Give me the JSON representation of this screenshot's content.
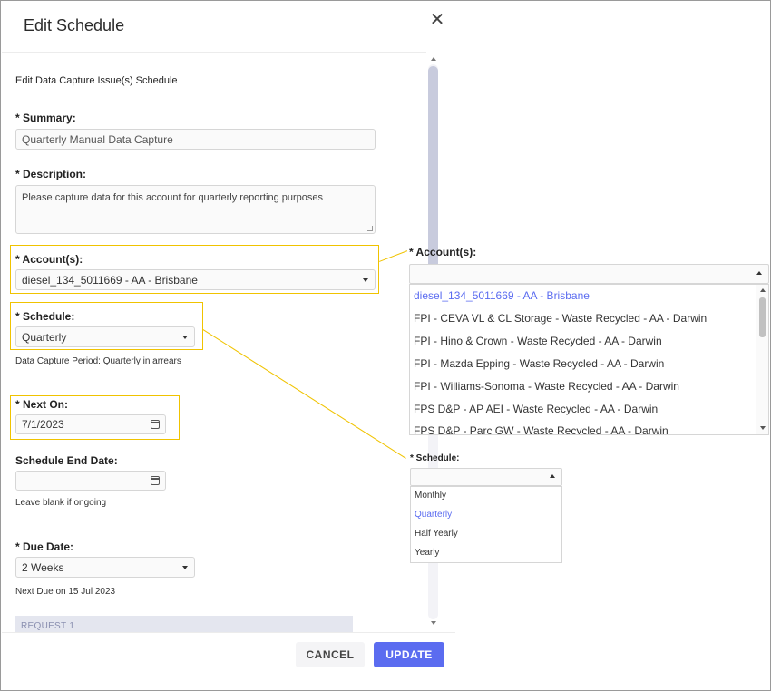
{
  "dialog": {
    "title": "Edit Schedule",
    "close_glyph": "✕"
  },
  "form": {
    "section_title": "Edit Data Capture Issue(s) Schedule",
    "summary": {
      "label": "* Summary:",
      "value": "Quarterly Manual Data Capture"
    },
    "description": {
      "label": "* Description:",
      "value": "Please capture data for this account for quarterly reporting purposes"
    },
    "accounts": {
      "label": "* Account(s):",
      "value": "diesel_134_5011669 - AA - Brisbane"
    },
    "schedule": {
      "label": "* Schedule:",
      "value": "Quarterly",
      "helper": "Data Capture Period: Quarterly in arrears"
    },
    "next_on": {
      "label": "* Next On:",
      "value": "7/1/2023"
    },
    "schedule_end": {
      "label": "Schedule End Date:",
      "value": "",
      "helper": "Leave blank if ongoing"
    },
    "due_date": {
      "label": "* Due Date:",
      "value": "2 Weeks",
      "helper": "Next Due on 15 Jul 2023"
    },
    "request_bar": "REQUEST 1"
  },
  "footer": {
    "cancel_label": "CANCEL",
    "update_label": "UPDATE"
  },
  "accounts_popup": {
    "label": "* Account(s):",
    "items": [
      {
        "label": "diesel_134_5011669 - AA - Brisbane",
        "selected": true
      },
      {
        "label": "FPI - CEVA VL & CL Storage - Waste Recycled - AA - Darwin",
        "selected": false
      },
      {
        "label": "FPI - Hino & Crown - Waste Recycled - AA - Darwin",
        "selected": false
      },
      {
        "label": "FPI - Mazda Epping - Waste Recycled - AA - Darwin",
        "selected": false
      },
      {
        "label": "FPI - Williams-Sonoma - Waste Recycled - AA - Darwin",
        "selected": false
      },
      {
        "label": "FPS D&P - AP AEI - Waste Recycled - AA - Darwin",
        "selected": false
      },
      {
        "label": "FPS D&P - Parc GW - Waste Recycled - AA - Darwin",
        "selected": false
      }
    ]
  },
  "schedule_popup": {
    "label": "* Schedule:",
    "items": [
      {
        "label": "Monthly",
        "selected": false
      },
      {
        "label": "Quarterly",
        "selected": true
      },
      {
        "label": "Half Yearly",
        "selected": false
      },
      {
        "label": "Yearly",
        "selected": false
      }
    ]
  },
  "colors": {
    "accent": "#5b6cf0",
    "highlight": "#f0c300"
  }
}
